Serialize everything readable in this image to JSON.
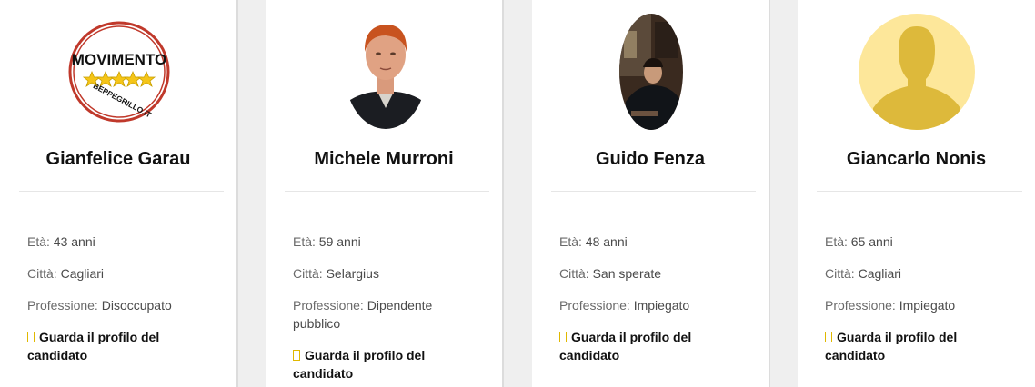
{
  "candidates": [
    {
      "name": "Gianfelice Garau",
      "avatar": "movimento-logo",
      "logo_text_top": "MOVIMENTO",
      "logo_text_bottom": "BEPPEGRILLO.IT",
      "age_label": "Età:",
      "age_value": "43 anni",
      "city_label": "Città:",
      "city_value": "Cagliari",
      "profession_label": "Professione:",
      "profession_value": "Disoccupato",
      "link_label": "Guarda il profilo del candidato"
    },
    {
      "name": "Michele Murroni",
      "avatar": "portrait-photo",
      "age_label": "Età:",
      "age_value": "59 anni",
      "city_label": "Città:",
      "city_value": "Selargius",
      "profession_label": "Professione:",
      "profession_value": "Dipendente pubblico",
      "link_label": "Guarda il profilo del candidato"
    },
    {
      "name": "Guido Fenza",
      "avatar": "portrait-photo-dark",
      "age_label": "Età:",
      "age_value": "48 anni",
      "city_label": "Città:",
      "city_value": "San sperate",
      "profession_label": "Professione:",
      "profession_value": "Impiegato",
      "link_label": "Guarda il profilo del candidato"
    },
    {
      "name": "Giancarlo Nonis",
      "avatar": "default-user-icon",
      "age_label": "Età:",
      "age_value": "65 anni",
      "city_label": "Città:",
      "city_value": "Cagliari",
      "profession_label": "Professione:",
      "profession_value": "Impiegato",
      "link_label": "Guarda il profilo del candidato"
    }
  ],
  "colors": {
    "card_bg": "#ffffff",
    "page_bg": "#efefef",
    "link_icon": "#e0b800",
    "default_avatar_bg": "#fde79a",
    "default_avatar_fg": "#ddb93b",
    "logo_red": "#c0392b",
    "logo_star": "#f5c518"
  }
}
